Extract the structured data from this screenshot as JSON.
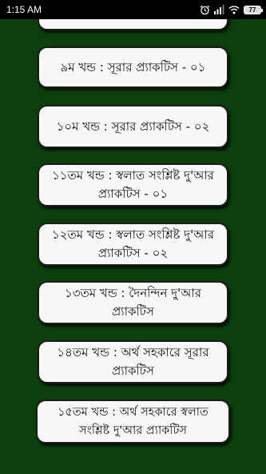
{
  "status_bar": {
    "time": "1:15 AM",
    "battery": "77"
  },
  "colors": {
    "background": "#0d3f0d",
    "card": "#f7f7f7",
    "card_border": "#1c1c1c",
    "text": "#111111"
  },
  "icons": [
    "alarm-icon",
    "signal-icon",
    "wifi-icon",
    "battery-icon"
  ],
  "list": {
    "items": [
      {
        "label": ""
      },
      {
        "label": "৯ম খন্ড : সূরার প্র্যাকটিস - ০১"
      },
      {
        "label": "১০ম খন্ড : সূরার প্র্যাকটিস - ০২"
      },
      {
        "label": "১১তম খন্ড : স্বলাত সংশ্লিষ্ট দু'আর প্র্যাকটিস - ০১"
      },
      {
        "label": "১২তম খন্ড : স্বলাত সংশ্লিষ্ট দু'আর প্র্যাকটিস - ০২"
      },
      {
        "label": "১৩তম খন্ড : দৈনন্দিন দু'আর প্র্যাকটিস"
      },
      {
        "label": "১৪তম খন্ড : অর্থ সহকারে সূরার প্র্যাকটিস"
      },
      {
        "label": "১৫তম খন্ড : অর্থ সহকারে স্বলাত সংশ্লিষ্ট দু'আর প্র্যাকটিস"
      }
    ]
  }
}
